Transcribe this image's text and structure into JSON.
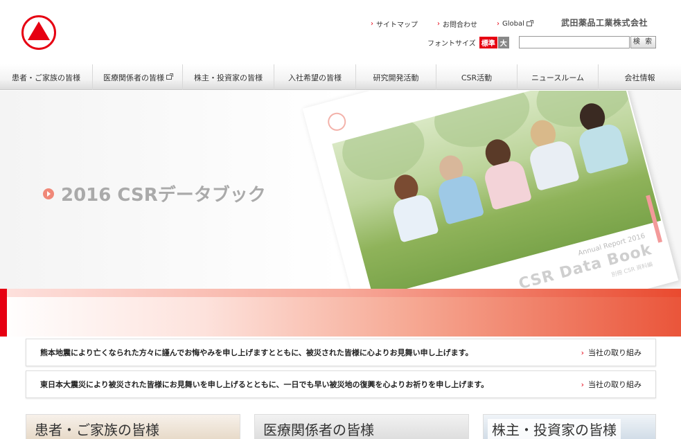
{
  "header": {
    "corp_name": "武田薬品工業株式会社",
    "util_links": [
      "サイトマップ",
      "お問合わせ",
      "Global"
    ],
    "font_size_label": "フォントサイズ",
    "font_size_std": "標準",
    "font_size_large": "大",
    "search_placeholder": "",
    "search_button": "検 索"
  },
  "nav": {
    "items": [
      "患者・ご家族の皆様",
      "医療関係者の皆様",
      "株主・投資家の皆様",
      "入社希望の皆様",
      "研究開発活動",
      "CSR活動",
      "ニュースルーム",
      "会社情報"
    ]
  },
  "hero": {
    "title": "2016 CSRデータブック",
    "book_line1": "Annual Report 2016",
    "book_line2": "CSR Data Book",
    "book_line3": "別冊 CSR 資料編"
  },
  "notices": [
    {
      "text": "熊本地震により亡くなられた方々に謹んでお悔やみを申し上げますとともに、被災された皆様に心よりお見舞い申し上げます。",
      "link": "当社の取り組み"
    },
    {
      "text": "東日本大震災により被災された皆様にお見舞いを申し上げるとともに、一日でも早い被災地の復興を心よりお祈りを申し上げます。",
      "link": "当社の取り組み"
    }
  ],
  "cards": [
    "患者・ご家族の皆様",
    "医療関係者の皆様",
    "株主・投資家の皆様"
  ],
  "colors": {
    "brand_red": "#e60012"
  }
}
